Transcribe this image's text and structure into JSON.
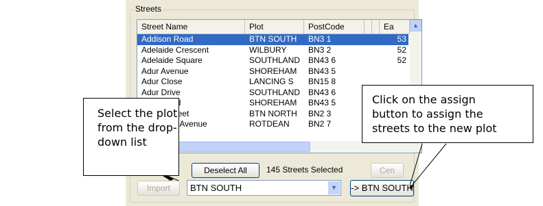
{
  "group": {
    "title": "Streets"
  },
  "columns": [
    "Street Name",
    "Plot",
    "PostCode",
    "Ea"
  ],
  "rows": [
    {
      "street": "Addison Road",
      "plot": "BTN SOUTH",
      "postcode": "BN3 1",
      "ea": "53",
      "selected": true
    },
    {
      "street": "Adelaide Crescent",
      "plot": "WILBURY",
      "postcode": "BN3 2",
      "ea": "52"
    },
    {
      "street": "Adelaide Square",
      "plot": "SOUTHLAND",
      "postcode": "BN43 6",
      "ea": "52"
    },
    {
      "street": "Adur Avenue",
      "plot": "SHOREHAM",
      "postcode": "BN43 5",
      "ea": ""
    },
    {
      "street": "Adur Close",
      "plot": "LANCING S",
      "postcode": "BN15 8",
      "ea": ""
    },
    {
      "street": "Adur Drive",
      "plot": "SOUTHLAND",
      "postcode": "BN43 6",
      "ea": ""
    },
    {
      "street": "Adur Road",
      "plot": "SHOREHAM",
      "postcode": "BN43 5",
      "ea": ""
    },
    {
      "street": "Agnes Street",
      "plot": "BTN NORTH",
      "postcode": "BN2 3",
      "ea": ""
    },
    {
      "street": "Ainsworth Avenue",
      "plot": "ROTDEAN",
      "postcode": "BN2 7",
      "ea": ""
    }
  ],
  "buttons": {
    "deselect_all": "Deselect All",
    "center": "Cen",
    "import": "Import",
    "assign": "-> BTN SOUTH"
  },
  "status": {
    "selected_count": "145 Streets Selected"
  },
  "plot_combo": {
    "value": "BTN SOUTH"
  },
  "callouts": {
    "left": [
      "Select the plot",
      "from the drop-",
      "down list"
    ],
    "right": [
      "Click on the assign",
      "button to assign the",
      "streets to the new plot"
    ]
  },
  "colors": {
    "selection": "#316ac5",
    "button_border": "#003c74",
    "panel_bg": "#ece9d8"
  }
}
